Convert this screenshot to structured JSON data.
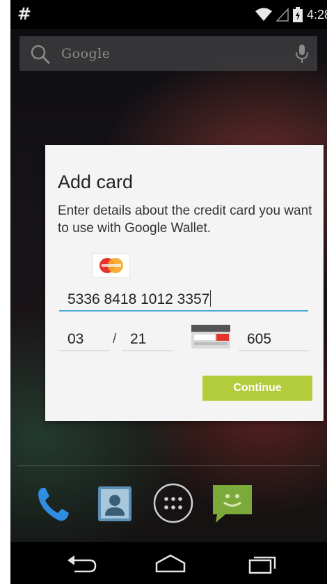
{
  "status_bar": {
    "notification_symbol": "#",
    "time": "4:28",
    "icons": [
      "wifi-icon",
      "signal-icon",
      "battery-icon"
    ]
  },
  "search": {
    "label": "Google",
    "icons": [
      "search-icon",
      "mic-icon"
    ]
  },
  "dialog": {
    "title": "Add card",
    "description": "Enter details about the credit card you want to use with Google Wallet.",
    "card_brand_icon": "mastercard-icon",
    "card_number": "5336 8418 1012 3357",
    "exp_month": "03",
    "exp_separator": "/",
    "exp_year": "21",
    "cvc_hint_icon": "card-back-icon",
    "cvc": "605",
    "continue_label": "Continue"
  },
  "dock": {
    "items": [
      "phone-icon",
      "contacts-icon",
      "app-drawer-icon",
      "messaging-icon"
    ]
  },
  "nav_bar": {
    "items": [
      "back-icon",
      "home-icon",
      "recents-icon"
    ]
  },
  "colors": {
    "accent_button": "#b3cc3b",
    "field_focus": "#4aa6d8",
    "dialog_bg": "#f4f4f4"
  }
}
